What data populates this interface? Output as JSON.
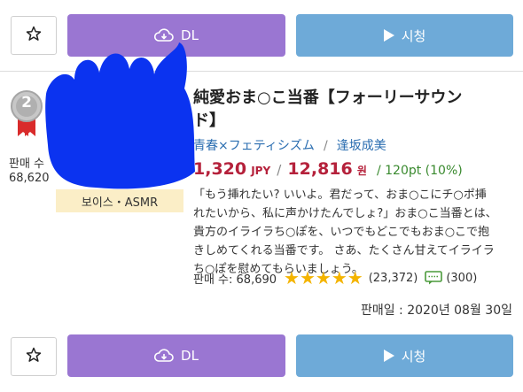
{
  "top_actions": {
    "dl_label": "DL",
    "watch_label": "시청"
  },
  "item": {
    "rank": "2",
    "title_line1": "純愛おま○こ当番【フォーリーサウン",
    "title_line2": "ド】",
    "genre": "青春×フェティシズム",
    "separator": "/",
    "author": "逢坂成美",
    "price_jpy": "1,320",
    "jpy_unit": "JPY",
    "price_slash": "/",
    "price_krw": "12,816",
    "krw_unit": "원",
    "points": "/ 120pt (10%)",
    "left_sales_label": "판매 수",
    "left_sales_value": "68,620",
    "category_tag": "보이스・ASMR",
    "description_lines": [
      "「もう挿れたい? いいよ。君だって、おま○こにチ○ポ挿",
      "れたいから、私に声かけたんでしょ?」おま○こ当番とは、",
      "貴方のイライラち○ぽを、いつでもどこでもおま○こで抱",
      "きしめてくれる当番です。 さあ、たくさん甘えてイライラ",
      "ち○ぽを慰めてもらいましょう。"
    ],
    "sales_label": "판매 수: 68,690",
    "rating_stars": 5,
    "rating_count": "(23,372)",
    "review_count": "(300)",
    "release_date": "판매일 : 2020년 08월 30일"
  },
  "bottom_actions": {
    "dl_label": "DL",
    "watch_label": "시청"
  },
  "colors": {
    "dl": "#9a76d2",
    "watch": "#6eaad8",
    "price": "#b5213b",
    "link": "#2a6db0",
    "points": "#3a8a2f",
    "star": "#f4b400",
    "redaction": "#0b33f0"
  },
  "icons": {
    "favorite": "star-outline-icon",
    "download": "cloud-download-icon",
    "play": "play-icon",
    "rank": "silver-medal-icon",
    "review": "comment-icon"
  }
}
